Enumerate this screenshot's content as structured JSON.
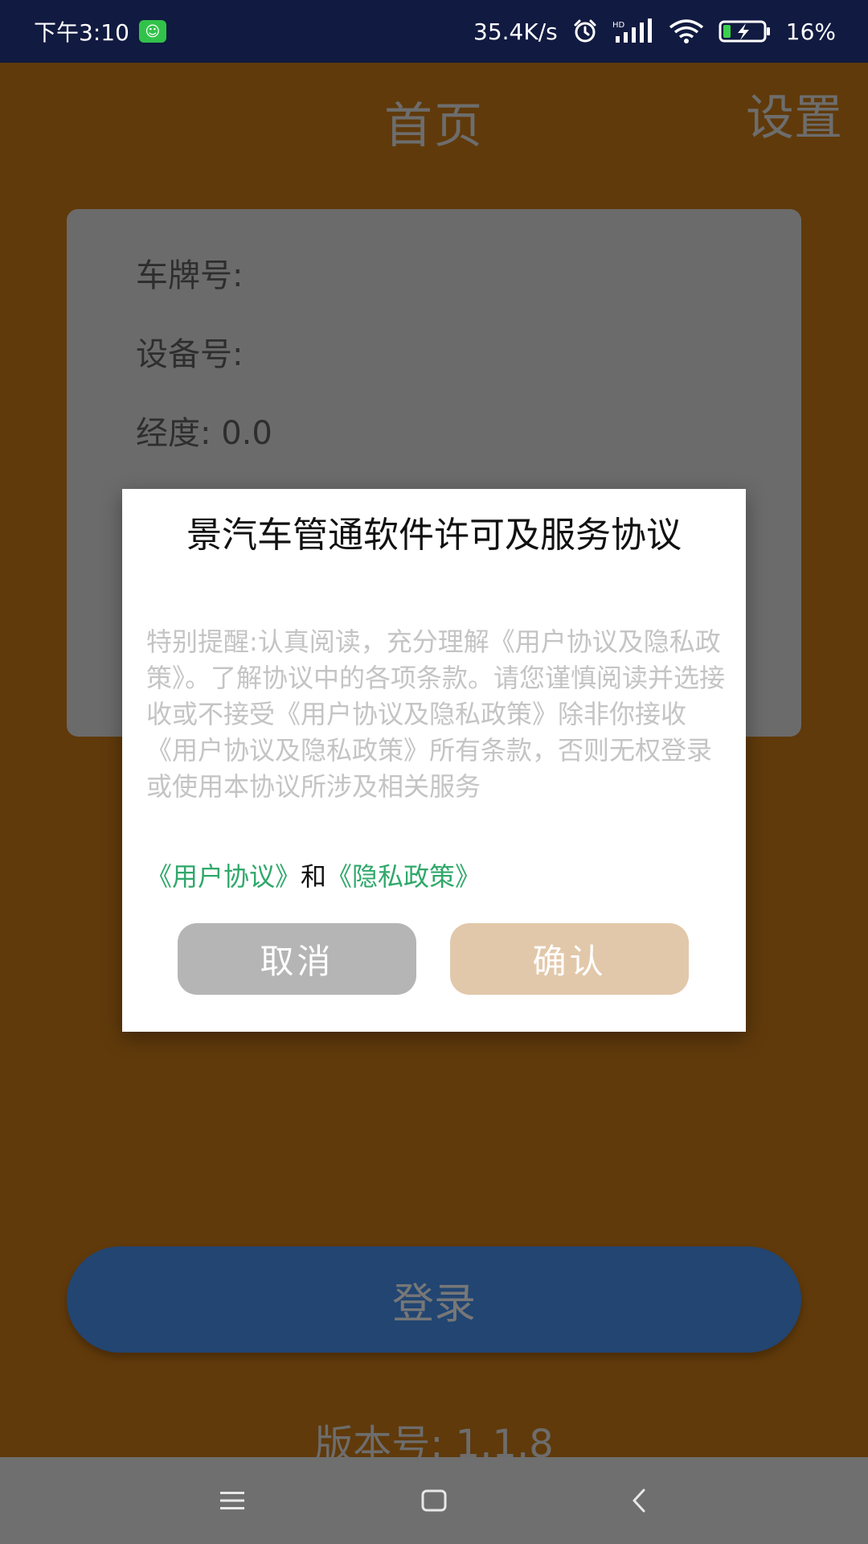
{
  "status_bar": {
    "time": "下午3:10",
    "net_speed": "35.4K/s",
    "hd_label": "HD",
    "battery_pct": "16%",
    "icons": [
      "notification-app-icon",
      "alarm-icon",
      "signal-icon",
      "wifi-icon",
      "battery-charging-icon"
    ]
  },
  "header": {
    "title": "首页",
    "settings": "设置"
  },
  "card": {
    "plate_label": "车牌号:",
    "device_label": "设备号:",
    "longitude_label": "经度:",
    "longitude_value": "0.0"
  },
  "login": {
    "label": "登录"
  },
  "version": {
    "label": "版本号:",
    "value": "1.1.8"
  },
  "dialog": {
    "title": "景汽车管通软件许可及服务协议",
    "body": "特别提醒:认真阅读，充分理解《用户协议及隐私政策》。了解协议中的各项条款。请您谨慎阅读并选接收或不接受《用户协议及隐私政策》除非你接收《用户协议及隐私政策》所有条款，否则无权登录或使用本协议所涉及相关服务",
    "link_user": "《用户协议》",
    "link_and": "和",
    "link_privacy": "《隐私政策》",
    "cancel": "取消",
    "confirm": "确认"
  },
  "colors": {
    "app_bg": "#b06a14",
    "status_bg": "#111a40",
    "link": "#2fa86a",
    "login_bg": "#3f7fd0",
    "confirm_bg": "#e2c8aa",
    "cancel_bg": "#b5b5b5"
  },
  "nav_bar": {
    "icons": [
      "menu-icon",
      "home-icon",
      "back-icon"
    ]
  }
}
